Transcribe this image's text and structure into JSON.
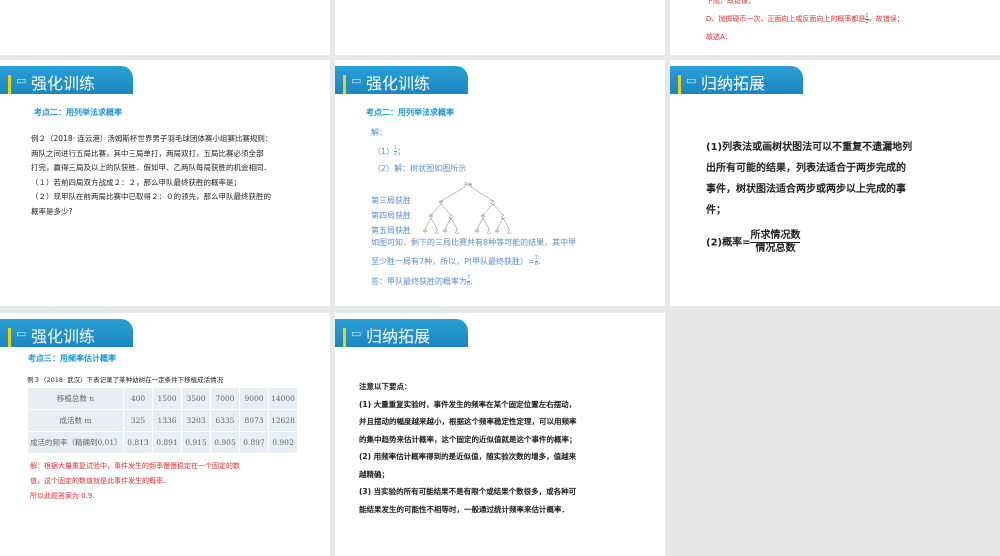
{
  "slides": [
    {
      "lines": [
        "下雨，故错误；",
        "D、抛掷硬币一次，正面向上或反面向上的概率都是",
        "，故错误；",
        "故选A．"
      ],
      "frac": {
        "n": "1",
        "d": "2"
      }
    },
    {
      "tab": "强化训练",
      "kp": "考点二：用列举法求概率",
      "lines": [
        "例２（2018· 连云港）汤姆斯杯世界男子羽毛球团体赛小组赛比赛规则：",
        "两队之间进行五局比赛，其中三局单打，两局双打，五局比赛必须全部",
        "打完，赢得三局及以上的队获胜．假如甲、乙两队每局获胜的机会相同．",
        "（１）若前四局双方战成２：２，那么甲队最终获胜的概率是；",
        "（２）现甲队在前两局比赛中已取得２：０的领先，那么甲队最终获胜的",
        "概率是多少?"
      ]
    },
    {
      "tab": "强化训练",
      "kp": "考点二：用列举法求概率",
      "jie": "解：",
      "p1": "（1）",
      "p1_end": "；",
      "p2": "（2）解：树状图如图所示",
      "levels": [
        "第三局获胜",
        "第四局获胜",
        "第五局获胜"
      ],
      "tree": {
        "root": "开始",
        "a": "甲",
        "b": "乙"
      },
      "c1": "如图可知，剩下的三局比赛共有8种等可能的结果，其中甲",
      "c2": "至少胜一局有7种，所以，P(甲队最终获胜）=",
      "ans": "答：甲队最终获胜的概率为",
      "half": {
        "n": "1",
        "d": "2"
      },
      "seven": {
        "n": "7",
        "d": "8"
      }
    },
    {
      "tab": "归纳拓展",
      "lines": [
        "(1)列表法或画树状图法可以不重复不遗漏地列",
        "出所有可能的结果，列表法适合于两步完成的",
        "事件，树状图法适合两步或两步以上完成的事",
        "件；"
      ],
      "p2": "(2)概率=",
      "num": "所求情况数",
      "den": "情况总数"
    },
    {
      "tab": "强化训练",
      "kp": "考点三：用频率估计概率",
      "ex": "例３（2018· 武汉）下表记录了某种幼树在一定条件下移植成活情况",
      "table": [
        [
          "移植总数 n",
          "400",
          "1500",
          "3500",
          "7000",
          "9000",
          "14000"
        ],
        [
          "成活数 m",
          "325",
          "1336",
          "3203",
          "6335",
          "8073",
          "12628"
        ],
        [
          "成活的频率（精确到0.01）",
          "0.813",
          "0.891",
          "0.915",
          "0.905",
          "0.897",
          "0.902"
        ]
      ],
      "sol": [
        "解：根据大量重复试验中，事件发生的频率慢慢稳定在一个固定的数",
        "值，这个固定的数值就是此事件发生的概率．",
        "所以此题答案为 0.9."
      ]
    },
    {
      "tab": "归纳拓展",
      "lines": [
        "注意以下要点：",
        "(1) 大量重复实验时，事件发生的频率在某个固定位置左右摆动，",
        "并且摆动的幅度越来越小，根据这个频率稳定性定理，可以用频率",
        "的集中趋势来估计概率，这个固定的近似值就是这个事件的概率；",
        "(2) 用频率估计概率得到的是近似值，随实验次数的增多，值越来",
        "越精确；",
        "(3) 当实验的所有可能结果不是有限个或结果个数很多，或各种可",
        "能结果发生的可能性不相等时，一般通过统计频率来估计概率．"
      ]
    }
  ]
}
